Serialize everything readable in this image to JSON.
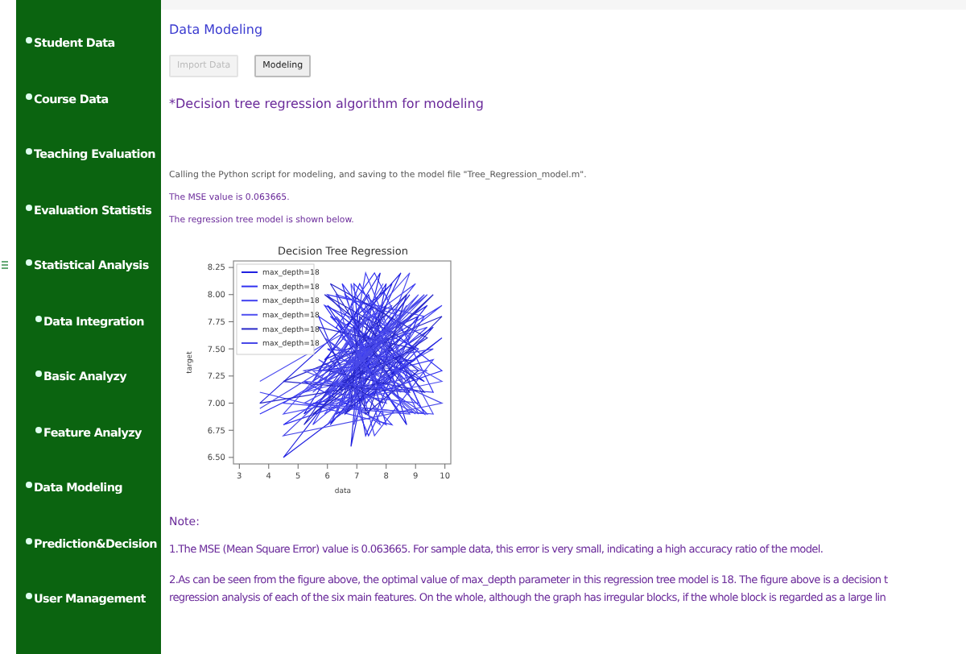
{
  "sidebar": {
    "items": [
      {
        "label": "Student Data"
      },
      {
        "label": "Course Data"
      },
      {
        "label": "Teaching Evaluation"
      },
      {
        "label": "Evaluation Statistis"
      },
      {
        "label": "Statistical Analysis",
        "expanded": true,
        "children": [
          {
            "label": "Data Integration"
          },
          {
            "label": "Basic Analyzy"
          },
          {
            "label": "Feature Analyzy"
          }
        ]
      },
      {
        "label": "Data Modeling"
      },
      {
        "label": "Prediction&Decision"
      },
      {
        "label": "User Management"
      }
    ]
  },
  "page": {
    "title": "Data Modeling",
    "buttons": [
      {
        "label": "Import Data",
        "disabled": true
      },
      {
        "label": "Modeling",
        "disabled": false
      }
    ],
    "heading": "*Decision tree regression algorithm for modeling",
    "messages": [
      "Calling the Python script for modeling, and saving to the model file \"Tree_Regression_model.m\".",
      "The MSE value is 0.063665.",
      "The regression tree model is shown below."
    ],
    "chart_data": {
      "type": "line",
      "title": "Decision Tree Regression",
      "xlabel": "data",
      "ylabel": "target",
      "xlim": [
        2.8,
        10.2
      ],
      "ylim": [
        6.44,
        8.31
      ],
      "xticks": [
        3,
        4,
        5,
        6,
        7,
        8,
        9,
        10
      ],
      "yticks": [
        {
          "value": 6.5,
          "label": "6.50"
        },
        {
          "value": 6.75,
          "label": "6.75"
        },
        {
          "value": 7.0,
          "label": "7.00"
        },
        {
          "value": 7.25,
          "label": "7.25"
        },
        {
          "value": 7.5,
          "label": "7.50"
        },
        {
          "value": 7.75,
          "label": "7.75"
        },
        {
          "value": 8.0,
          "label": "8.00"
        },
        {
          "value": 8.25,
          "label": "8.25"
        }
      ],
      "x": [
        3.7,
        8.2,
        6.1,
        9.4,
        5.5,
        7.8,
        6.6,
        9.9,
        4.5,
        8.8,
        6.9,
        7.3,
        9.1,
        5.9,
        8.5,
        6.3,
        7.6,
        9.6,
        5.2,
        8.0,
        6.8,
        7.1,
        9.3,
        6.0,
        8.7,
        7.4,
        5.7,
        9.0,
        6.5,
        7.9
      ],
      "series": [
        {
          "name": "max_depth=18",
          "color": "#2020e0",
          "values": [
            7.0,
            8.1,
            6.8,
            7.9,
            7.2,
            8.2,
            6.9,
            7.6,
            6.5,
            8.0,
            7.3,
            6.7,
            7.8,
            7.4,
            8.2,
            6.9,
            7.1,
            7.7,
            6.9,
            8.1,
            6.6,
            7.5,
            7.2,
            7.9,
            6.8,
            8.0,
            7.3,
            7.4,
            7.0,
            7.6
          ]
        },
        {
          "name": "max_depth=18",
          "color": "#3030f0",
          "values": [
            6.9,
            7.5,
            7.8,
            6.9,
            7.0,
            7.1,
            8.0,
            7.3,
            6.8,
            7.6,
            8.1,
            7.0,
            7.5,
            7.9,
            6.9,
            7.7,
            8.2,
            7.1,
            7.2,
            6.8,
            7.9,
            8.1,
            6.9,
            7.5,
            7.4,
            6.7,
            7.8,
            7.2,
            8.1,
            6.9
          ]
        },
        {
          "name": "max_depth=18",
          "color": "#4040f0",
          "values": [
            7.1,
            6.8,
            7.4,
            7.7,
            6.8,
            7.9,
            7.2,
            7.9,
            7.0,
            6.9,
            7.6,
            8.2,
            7.0,
            7.1,
            7.8,
            8.0,
            6.7,
            7.4,
            7.1,
            7.6,
            7.3,
            6.9,
            7.8,
            8.0,
            7.2,
            7.5,
            7.0,
            8.1,
            7.6,
            7.3
          ]
        },
        {
          "name": "max_depth=18",
          "color": "#5050f0",
          "values": [
            7.2,
            7.9,
            7.0,
            7.3,
            7.3,
            6.8,
            7.7,
            7.2,
            6.9,
            8.2,
            6.8,
            7.5,
            8.0,
            6.9,
            7.3,
            7.4,
            7.9,
            6.9,
            7.0,
            7.4,
            8.1,
            7.2,
            7.6,
            6.8,
            7.9,
            7.1,
            7.4,
            6.9,
            7.5,
            8.1
          ]
        },
        {
          "name": "max_depth=18",
          "color": "#2828c8",
          "values": [
            7.0,
            7.2,
            8.1,
            7.6,
            6.9,
            7.4,
            6.9,
            7.8,
            7.2,
            7.1,
            7.7,
            6.9,
            7.3,
            8.0,
            7.6,
            7.1,
            7.5,
            8.0,
            6.8,
            7.9,
            7.0,
            7.8,
            7.1,
            7.3,
            8.0,
            6.9,
            7.7,
            7.5,
            7.2,
            7.0
          ]
        },
        {
          "name": "max_depth=18",
          "color": "#4848e8",
          "values": [
            6.95,
            7.7,
            7.1,
            8.0,
            7.1,
            7.6,
            7.4,
            7.0,
            6.7,
            7.8,
            7.1,
            7.9,
            6.9,
            7.6,
            7.1,
            7.8,
            7.2,
            7.5,
            7.3,
            7.0,
            7.6,
            7.4,
            8.0,
            7.2,
            7.1,
            7.8,
            7.2,
            7.7,
            6.9,
            7.5
          ]
        }
      ]
    },
    "note": {
      "title": "Note:",
      "lines": [
        "1.The MSE (Mean Square Error) value is 0.063665. For sample data, this error is very small, indicating a high accuracy ratio of the model.",
        "2.As can be seen from the figure above, the optimal value of max_depth parameter in this regression tree model is 18. The figure above is a decision t",
        "regression analysis of each of the six main features. On the whole, although the graph has irregular blocks, if the whole block is regarded as a large lin"
      ]
    }
  }
}
